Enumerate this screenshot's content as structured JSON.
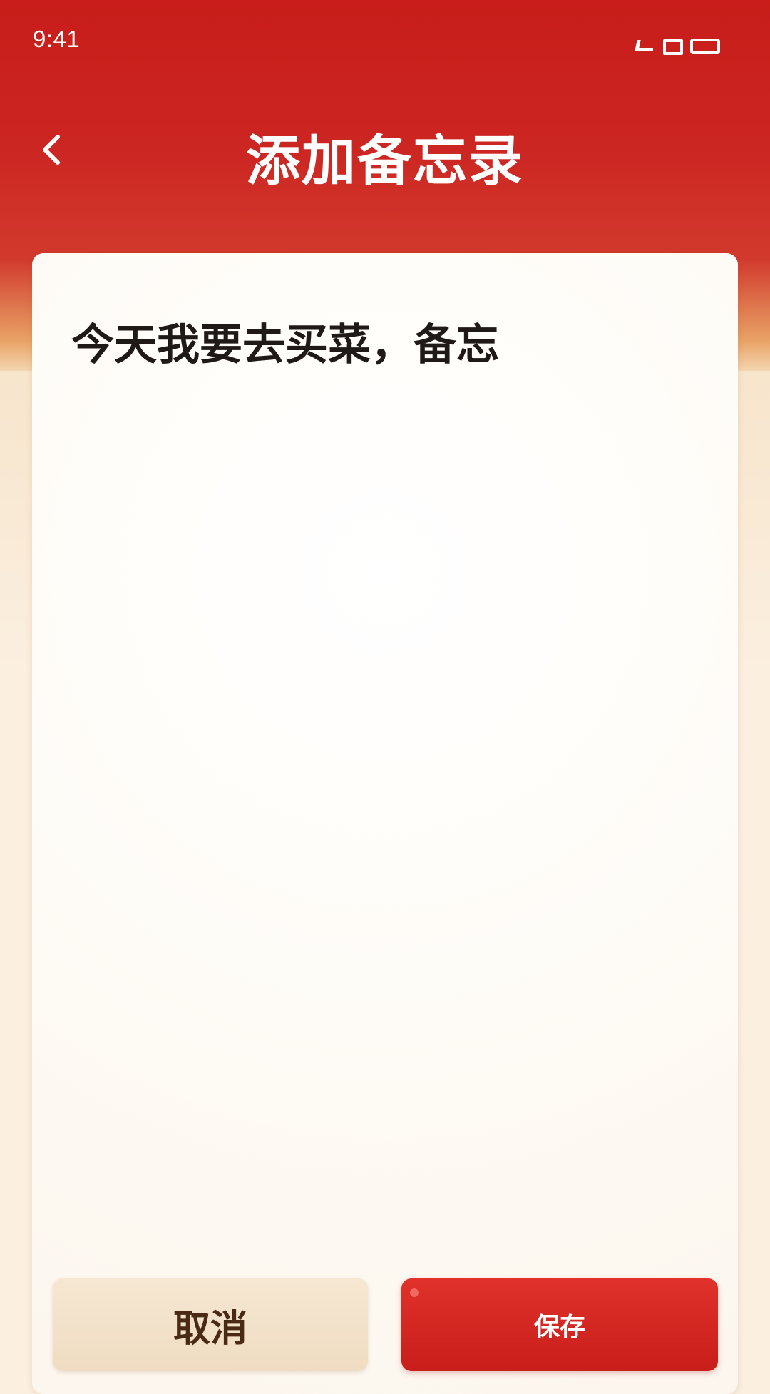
{
  "status_bar": {
    "time": "9:41",
    "icons": [
      "signal-icon",
      "wifi-icon",
      "battery-icon"
    ]
  },
  "header": {
    "title": "添加备忘录",
    "back_icon": "chevron-left-icon"
  },
  "memo": {
    "content": "今天我要去买菜，备忘"
  },
  "actions": {
    "cancel_label": "取消",
    "save_label": "保存"
  },
  "colors": {
    "primary_red": "#c81d1a",
    "cancel_bg": "#f6e7d2",
    "cancel_text": "#4a2a14",
    "card_bg": "#fffdf9",
    "text_dark": "#1f1a17"
  }
}
